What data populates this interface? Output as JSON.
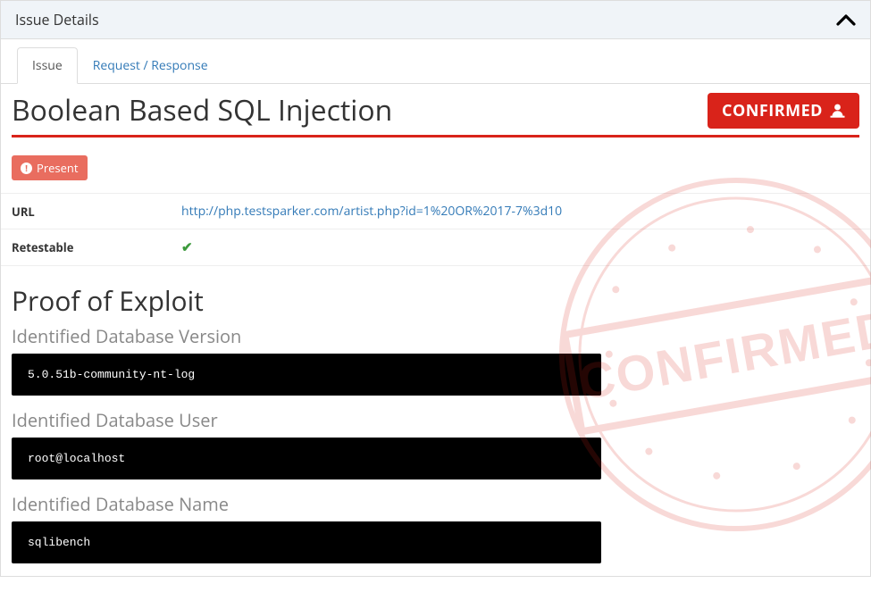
{
  "panel": {
    "title": "Issue Details"
  },
  "tabs": {
    "issue": "Issue",
    "request_response": "Request / Response"
  },
  "issue": {
    "title": "Boolean Based SQL Injection",
    "confirmed_label": "CONFIRMED",
    "status_badge": "Present",
    "kv": {
      "url_label": "URL",
      "url_value": "http://php.testsparker.com/artist.php?id=1%20OR%2017-7%3d10",
      "retestable_label": "Retestable"
    },
    "proof": {
      "heading": "Proof of Exploit",
      "db_version_label": "Identified Database Version",
      "db_version_value": "5.0.51b-community-nt-log",
      "db_user_label": "Identified Database User",
      "db_user_value": "root@localhost",
      "db_name_label": "Identified Database Name",
      "db_name_value": "sqlibench"
    }
  },
  "stamp_text": "CONFIRMED"
}
